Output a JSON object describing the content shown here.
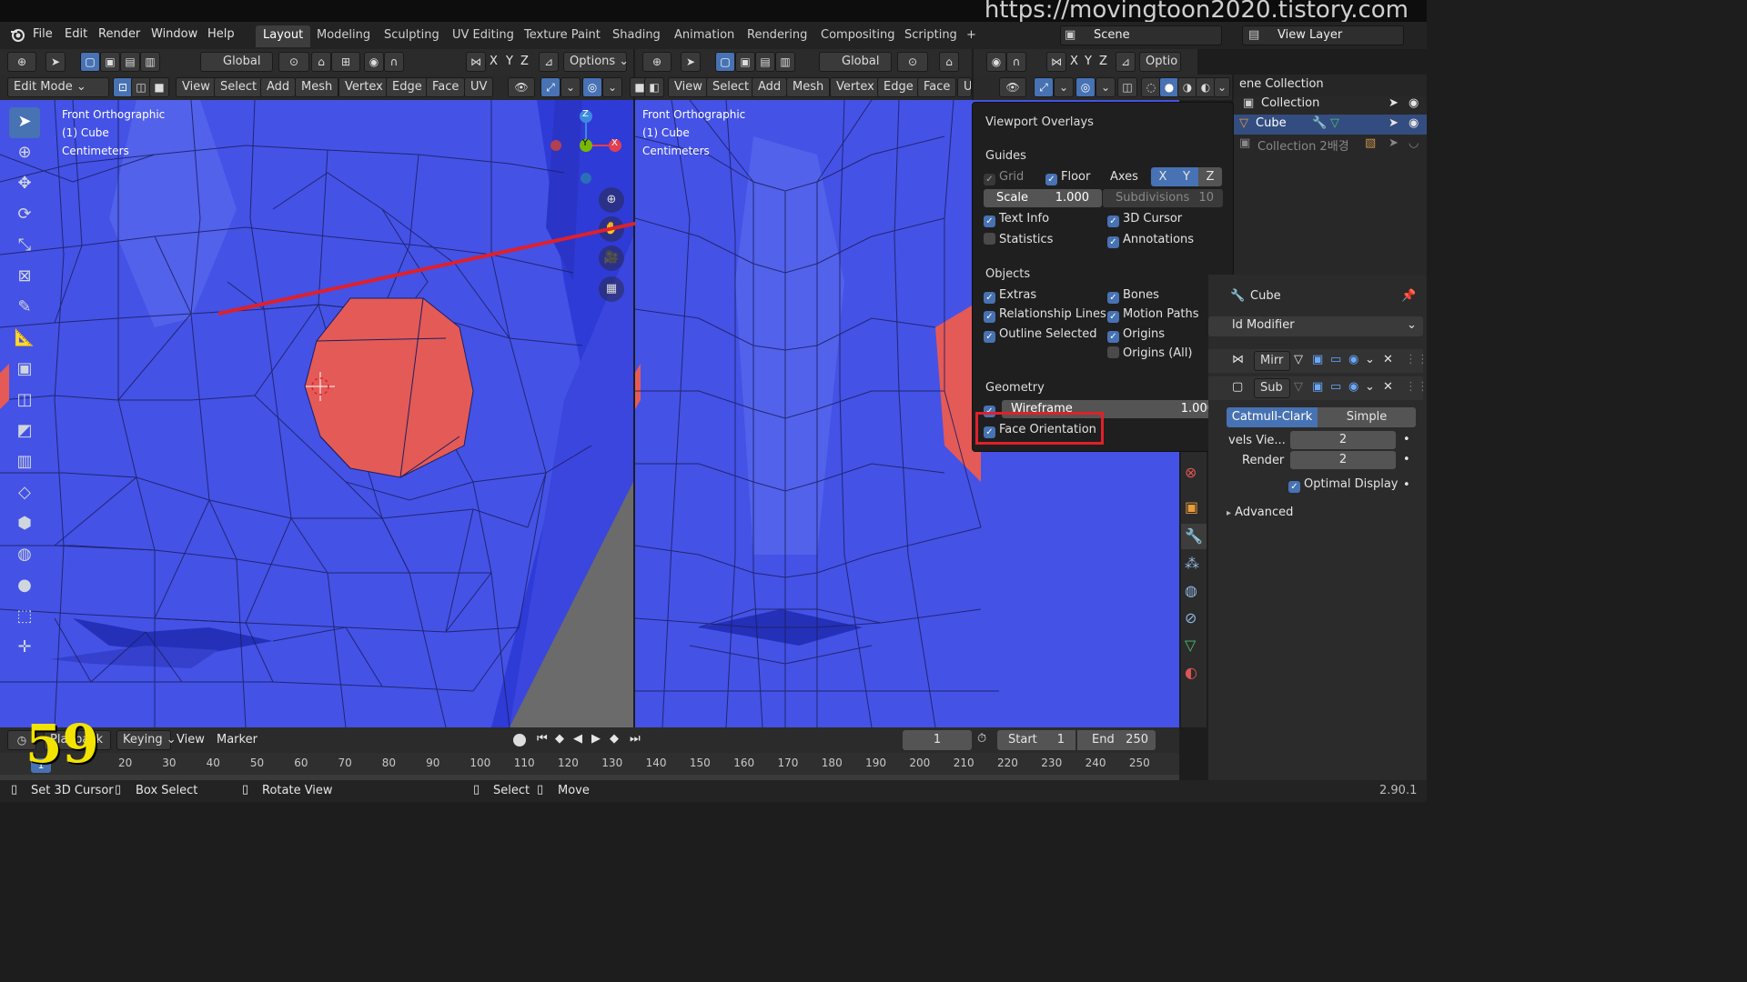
{
  "watermark": {
    "url": "https://movingtoon2020.tistory.com",
    "frame_number": "59"
  },
  "menubar": {
    "items": [
      "File",
      "Edit",
      "Render",
      "Window",
      "Help"
    ],
    "workspaces": [
      "Layout",
      "Modeling",
      "Sculpting",
      "UV Editing",
      "Texture Paint",
      "Shading",
      "Animation",
      "Rendering",
      "Compositing",
      "Scripting"
    ],
    "add_tab": "+",
    "scene_label": "Scene",
    "view_layer_label": "View Layer"
  },
  "left_view": {
    "header": {
      "orientation": "Global",
      "options": "Options",
      "axes": [
        "X",
        "Y",
        "Z"
      ]
    },
    "mode_header": {
      "mode": "Edit Mode",
      "menus": [
        "View",
        "Select",
        "Add",
        "Mesh",
        "Vertex",
        "Edge",
        "Face",
        "UV"
      ]
    },
    "info": {
      "view": "Front Orthographic",
      "object": "(1) Cube",
      "units": "Centimeters"
    },
    "gizmo": {
      "z": "Z",
      "y": "Y",
      "x": "X"
    }
  },
  "right_view": {
    "header": {
      "orientation": "Global",
      "options": "Optio",
      "axes": [
        "X",
        "Y",
        "Z"
      ]
    },
    "mode_header": {
      "menus": [
        "View",
        "Select",
        "Add",
        "Mesh",
        "Vertex",
        "Edge",
        "Face",
        "U"
      ]
    },
    "info": {
      "view": "Front Orthographic",
      "object": "(1) Cube",
      "units": "Centimeters"
    }
  },
  "overlays": {
    "title": "Viewport Overlays",
    "guides": {
      "heading": "Guides",
      "grid": "Grid",
      "floor": "Floor",
      "axes_label": "Axes",
      "axes": [
        "X",
        "Y",
        "Z"
      ],
      "scale_label": "Scale",
      "scale_value": "1.000",
      "subdivisions_label": "Subdivisions",
      "subdivisions_value": "10",
      "text_info": "Text Info",
      "cursor_3d": "3D Cursor",
      "statistics": "Statistics",
      "annotations": "Annotations"
    },
    "objects": {
      "heading": "Objects",
      "extras": "Extras",
      "bones": "Bones",
      "relationship_lines": "Relationship Lines",
      "motion_paths": "Motion Paths",
      "outline_selected": "Outline Selected",
      "origins": "Origins",
      "origins_all": "Origins (All)"
    },
    "geometry": {
      "heading": "Geometry",
      "wireframe_label": "Wireframe",
      "wireframe_value": "1.000",
      "face_orientation": "Face Orientation"
    }
  },
  "outliner": {
    "scene_collection": "ene Collection",
    "items": [
      {
        "label": "Collection"
      },
      {
        "label": "Cube"
      },
      {
        "label": "Collection 2배경"
      }
    ]
  },
  "properties": {
    "object_name": "Cube",
    "add_modifier": "ld Modifier",
    "modifiers": [
      {
        "name": "Mirr"
      },
      {
        "name": "Sub"
      }
    ],
    "subdiv": {
      "catmull": "Catmull-Clark",
      "simple": "Simple",
      "levels_label": "vels Vie...",
      "levels_value": "2",
      "render_label": "Render",
      "render_value": "2",
      "optimal_display": "Optimal Display",
      "advanced": "Advanced"
    }
  },
  "timeline": {
    "playback": "Playback",
    "keying": "Keying",
    "view": "View",
    "marker": "Marker",
    "current_frame": "1",
    "start_label": "Start",
    "start_value": "1",
    "end_label": "End",
    "end_value": "250",
    "ticks": [
      "20",
      "30",
      "40",
      "50",
      "60",
      "70",
      "80",
      "90",
      "100",
      "110",
      "120",
      "130",
      "140",
      "150",
      "160",
      "170",
      "180",
      "190",
      "200",
      "210",
      "220",
      "230",
      "240",
      "250"
    ]
  },
  "statusbar": {
    "set_cursor": "Set 3D Cursor",
    "box_select": "Box Select",
    "rotate_view": "Rotate View",
    "select": "Select",
    "move": "Move",
    "version": "2.90.1"
  },
  "colors": {
    "face_front": "#4452e6",
    "face_back": "#e45a57",
    "accent": "#4772b3",
    "annotation_red": "#e0202a"
  }
}
